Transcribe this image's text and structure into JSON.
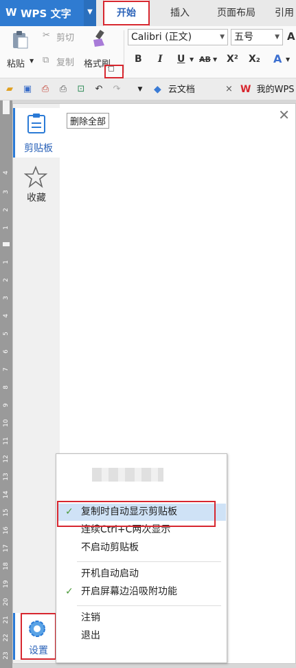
{
  "titlebar": {
    "logo": "W",
    "app_title": "WPS 文字",
    "tabs": [
      {
        "label": "开始",
        "active": true
      },
      {
        "label": "插入"
      },
      {
        "label": "页面布局"
      },
      {
        "label": "引用"
      }
    ]
  },
  "ribbon": {
    "paste_label": "粘贴",
    "cut_label": "剪切",
    "copy_label": "复制",
    "format_painter_label": "格式刷",
    "font_name": "Calibri (正文)",
    "font_size": "五号",
    "bold": "B",
    "italic": "I",
    "underline": "U",
    "strikethrough": "AB",
    "superscript": "X²",
    "subscript": "X₂",
    "font_color_label": "A",
    "font_size_cut": "A"
  },
  "quick_access": {
    "cloud_doc_label": "云文档",
    "my_wps_label": "我的WPS"
  },
  "ruler": {
    "top_numbers": [
      "4",
      "3",
      "2",
      "1"
    ],
    "bottom_numbers": [
      "1",
      "2",
      "3",
      "4",
      "5",
      "6",
      "7",
      "8",
      "9",
      "10",
      "11",
      "12",
      "13",
      "14",
      "15",
      "16",
      "17",
      "18",
      "19",
      "20",
      "21",
      "22",
      "23"
    ]
  },
  "pane": {
    "sidebar": {
      "clipboard_label": "剪贴板",
      "favorites_label": "收藏",
      "settings_label": "设置"
    },
    "clear_all_label": "删除全部",
    "close_symbol": "✕"
  },
  "menu": {
    "items": [
      {
        "label": "复制时自动显示剪贴板",
        "checked": true,
        "highlighted": true
      },
      {
        "label": "连续Ctrl+C两次显示",
        "checked": false
      },
      {
        "label": "不启动剪贴板",
        "checked": false
      },
      {
        "label": "开机自动启动",
        "checked": false
      },
      {
        "label": "开启屏幕边沿吸附功能",
        "checked": true
      },
      {
        "label": "注销",
        "checked": false
      },
      {
        "label": "退出",
        "checked": false
      }
    ],
    "check_symbol": "✓"
  },
  "colors": {
    "accent": "#2f7bd1",
    "highlight_red": "#d7262e",
    "menu_highlight": "#cfe2f6"
  }
}
